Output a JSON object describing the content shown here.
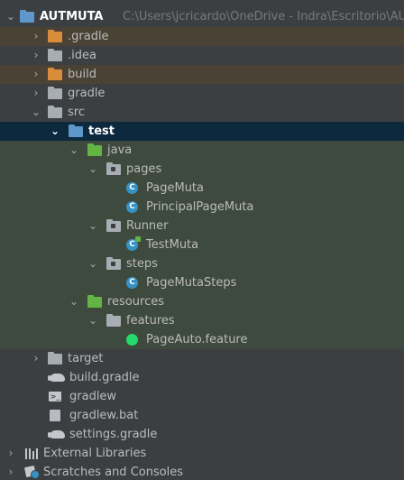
{
  "project_tree": {
    "root": {
      "name": "AUTMUTA",
      "path": "C:\\Users\\jcricardo\\OneDrive - Indra\\Escritorio\\AUT"
    },
    "items": [
      {
        "label": ".gradle"
      },
      {
        "label": ".idea"
      },
      {
        "label": "build"
      },
      {
        "label": "gradle"
      },
      {
        "label": "src"
      },
      {
        "label": "test"
      },
      {
        "label": "java"
      },
      {
        "label": "pages"
      },
      {
        "label": "PageMuta"
      },
      {
        "label": "PrincipalPageMuta"
      },
      {
        "label": "Runner"
      },
      {
        "label": "TestMuta"
      },
      {
        "label": "steps"
      },
      {
        "label": "PageMutaSteps"
      },
      {
        "label": "resources"
      },
      {
        "label": "features"
      },
      {
        "label": "PageAuto.feature"
      },
      {
        "label": "target"
      },
      {
        "label": "build.gradle"
      },
      {
        "label": "gradlew"
      },
      {
        "label": "gradlew.bat"
      },
      {
        "label": "settings.gradle"
      }
    ],
    "external_libraries": "External Libraries",
    "scratches": "Scratches and Consoles"
  },
  "colors": {
    "background": "#3c3f41",
    "excluded_row": "#4a4235",
    "test_row": "#3e4a3d",
    "selected_row": "#0d293e",
    "class_icon": "#3592c4",
    "folder_orange": "#d98d3a",
    "folder_green": "#62b543"
  }
}
